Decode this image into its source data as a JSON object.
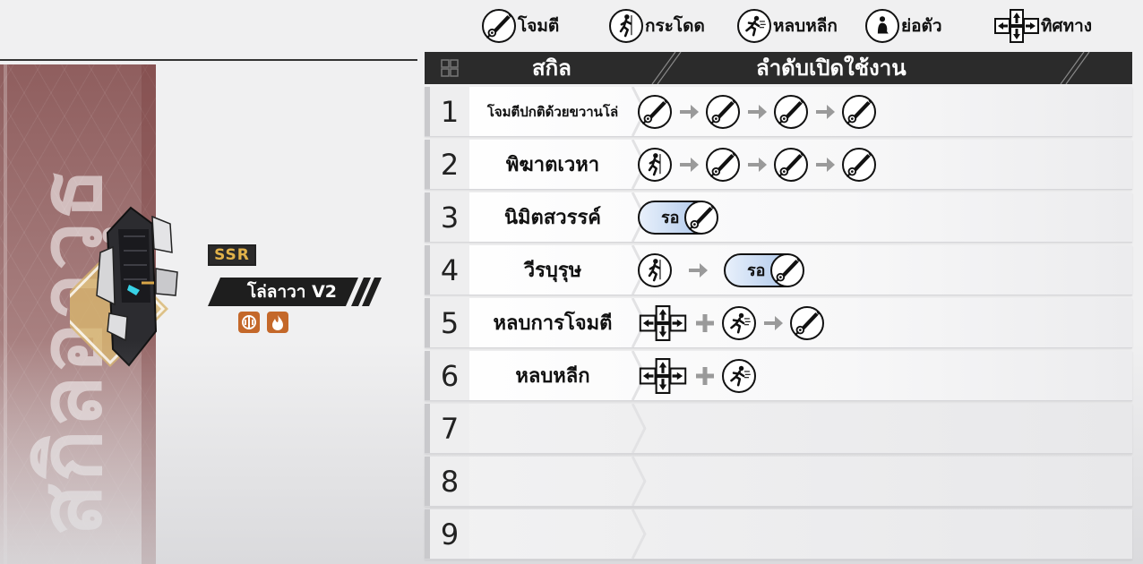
{
  "legend": {
    "attack": "โจมตี",
    "jump": "กระโดด",
    "dodge": "หลบหลีก",
    "crouch": "ย่อตัว",
    "direction": "ทิศทาง"
  },
  "banner_text": "สกิลอาวุธ",
  "weapon": {
    "rarity": "SSR",
    "name": "โล่ลาวา V2",
    "colors": {
      "rarity_gold": "#e2b24a",
      "element_bg": "#c4682a"
    }
  },
  "table": {
    "header_skill": "สกิล",
    "header_order": "ลำดับเปิดใช้งาน",
    "hold_label": "รอ",
    "rows": [
      {
        "num": "1",
        "skill": "โจมตีปกติด้วยขวานโล่"
      },
      {
        "num": "2",
        "skill": "พิฆาตเวหา"
      },
      {
        "num": "3",
        "skill": "นิมิตสวรรค์"
      },
      {
        "num": "4",
        "skill": "วีรบุรุษ"
      },
      {
        "num": "5",
        "skill": "หลบการโจมตี"
      },
      {
        "num": "6",
        "skill": "หลบหลีก"
      },
      {
        "num": "7",
        "skill": ""
      },
      {
        "num": "8",
        "skill": ""
      },
      {
        "num": "9",
        "skill": ""
      }
    ]
  }
}
